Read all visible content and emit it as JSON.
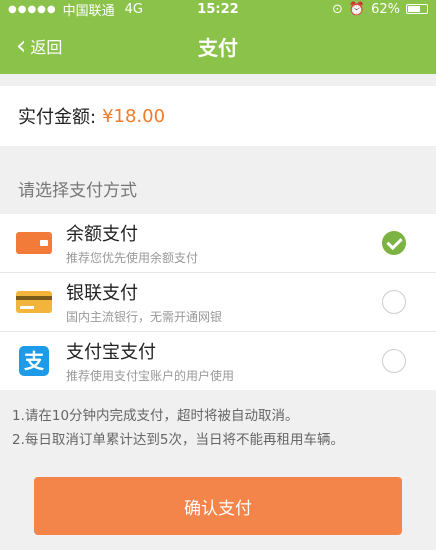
{
  "status_bar": {
    "carrier": "中国联通",
    "network": "4G",
    "time": "15:22",
    "battery_percent": "62%",
    "signal_dots": "●●●●●"
  },
  "nav": {
    "back_label": "返回",
    "title": "支付"
  },
  "amount": {
    "label": "实付金额:",
    "value": "¥18.00"
  },
  "payment_section": {
    "title": "请选择支付方式",
    "methods": [
      {
        "name": "余额支付",
        "desc": "推荐您优先使用余额支付",
        "icon": "wallet-icon",
        "selected": true
      },
      {
        "name": "银联支付",
        "desc": "国内主流银行，无需开通网银",
        "icon": "bank-card-icon",
        "selected": false
      },
      {
        "name": "支付宝支付",
        "desc": "推荐使用支付宝账户的用户使用",
        "icon": "alipay-icon",
        "icon_glyph": "支",
        "selected": false
      }
    ]
  },
  "notes": [
    "1.请在10分钟内完成支付，超时将被自动取消。",
    "2.每日取消订单累计达到5次，当日将不能再租用车辆。"
  ],
  "confirm_label": "确认支付",
  "colors": {
    "primary_green": "#8bc34a",
    "amount_orange": "#f07c2a",
    "confirm_orange": "#f3844a",
    "alipay_blue": "#1e9be8"
  }
}
